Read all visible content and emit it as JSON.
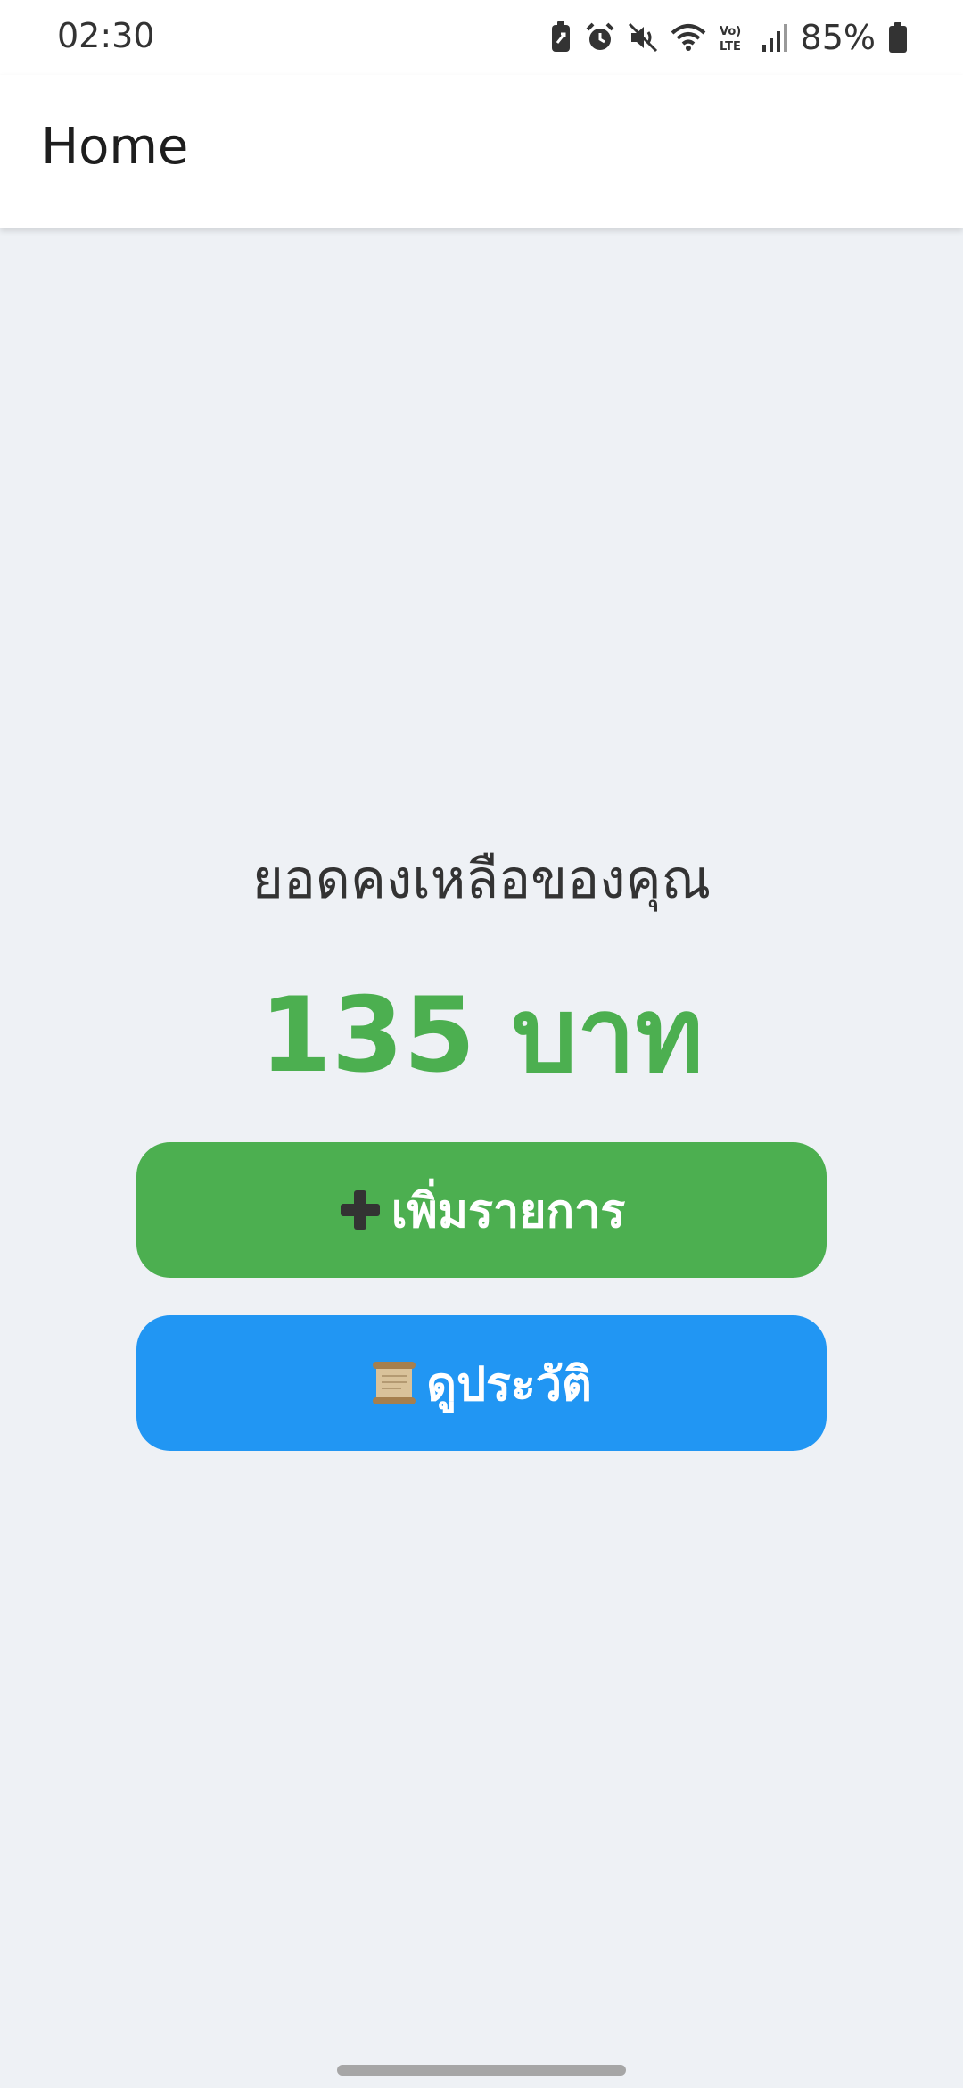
{
  "status_bar": {
    "time": "02:30",
    "battery_percent": "85%",
    "icons": [
      "battery-saver-icon",
      "alarm-icon",
      "mute-icon",
      "wifi-icon",
      "volte-icon",
      "signal-icon",
      "battery-icon"
    ]
  },
  "app_bar": {
    "title": "Home"
  },
  "balance": {
    "label": "ยอดคงเหลือของคุณ",
    "value": "135 บาท",
    "color": "#4caf50"
  },
  "actions": {
    "add": {
      "icon": "plus-icon",
      "label": "เพิ่มรายการ",
      "color": "#4caf50"
    },
    "history": {
      "icon": "scroll-icon",
      "label": "ดูประวัติ",
      "color": "#2196f3"
    }
  }
}
